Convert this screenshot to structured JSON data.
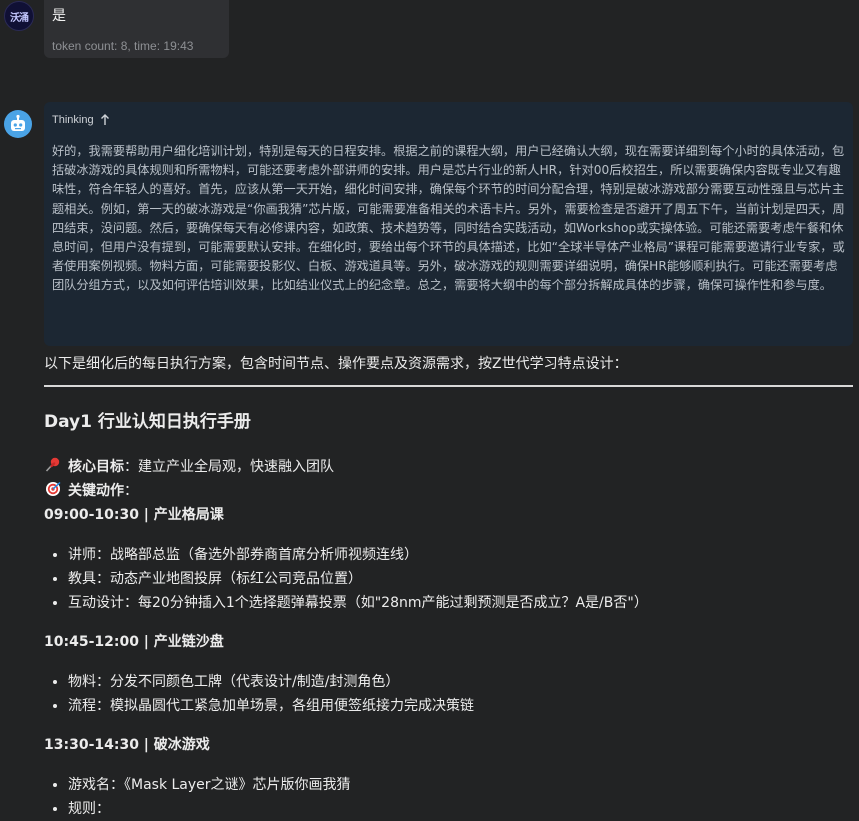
{
  "user_message": {
    "avatar_text": "沃涌",
    "text": "是",
    "meta": "token count: 8, time: 19:43"
  },
  "thinking": {
    "label": "Thinking",
    "text": "好的，我需要帮助用户细化培训计划，特别是每天的日程安排。根据之前的课程大纲，用户已经确认大纲，现在需要详细到每个小时的具体活动，包括破冰游戏的具体规则和所需物料，可能还要考虑外部讲师的安排。用户是芯片行业的新人HR，针对00后校招生，所以需要确保内容既专业又有趣味性，符合年轻人的喜好。首先，应该从第一天开始，细化时间安排，确保每个环节的时间分配合理，特别是破冰游戏部分需要互动性强且与芯片主题相关。例如，第一天的破冰游戏是“你画我猜”芯片版，可能需要准备相关的术语卡片。另外，需要检查是否避开了周五下午，当前计划是四天，周四结束，没问题。然后，要确保每天有必修课内容，如政策、技术趋势等，同时结合实践活动，如Workshop或实操体验。可能还需要考虑午餐和休息时间，但用户没有提到，可能需要默认安排。在细化时，要给出每个环节的具体描述，比如“全球半导体产业格局”课程可能需要邀请行业专家，或者使用案例视频。物料方面，可能需要投影仪、白板、游戏道具等。另外，破冰游戏的规则需要详细说明，确保HR能够顺利执行。可能还需要考虑团队分组方式，以及如何评估培训效果，比如结业仪式上的纪念章。总之，需要将大纲中的每个部分拆解成具体的步骤，确保可操作性和参与度。"
  },
  "answer": {
    "intro": "以下是细化后的每日执行方案，包含时间节点、操作要点及资源需求，按Z世代学习特点设计：",
    "day_title": "Day1 行业认知日执行手册",
    "goal_label": "核心目标",
    "goal_text": "：建立产业全局观，快速融入团队",
    "action_label": "关键动作",
    "action_colon": "：",
    "sections": [
      {
        "time": "09:00-10:30 | 产业格局课",
        "items": [
          "讲师：战略部总监（备选外部券商首席分析师视频连线）",
          "教具：动态产业地图投屏（标红公司竞品位置）",
          "互动设计：每20分钟插入1个选择题弹幕投票（如\"28nm产能过剩预测是否成立？A是/B否\"）"
        ]
      },
      {
        "time": "10:45-12:00 | 产业链沙盘",
        "items": [
          "物料：分发不同颜色工牌（代表设计/制造/封测角色）",
          "流程：模拟晶圆代工紧急加单场景，各组用便签纸接力完成决策链"
        ]
      },
      {
        "time": "13:30-14:30 | 破冰游戏",
        "items": [
          "游戏名：《Mask Layer之谜》芯片版你画我猜",
          "规则："
        ]
      }
    ]
  },
  "colors": {
    "background": "#222324",
    "user_bubble": "#2f3033",
    "thinking_bg": "#1c2733",
    "bot_avatar": "#4aa3e6"
  }
}
